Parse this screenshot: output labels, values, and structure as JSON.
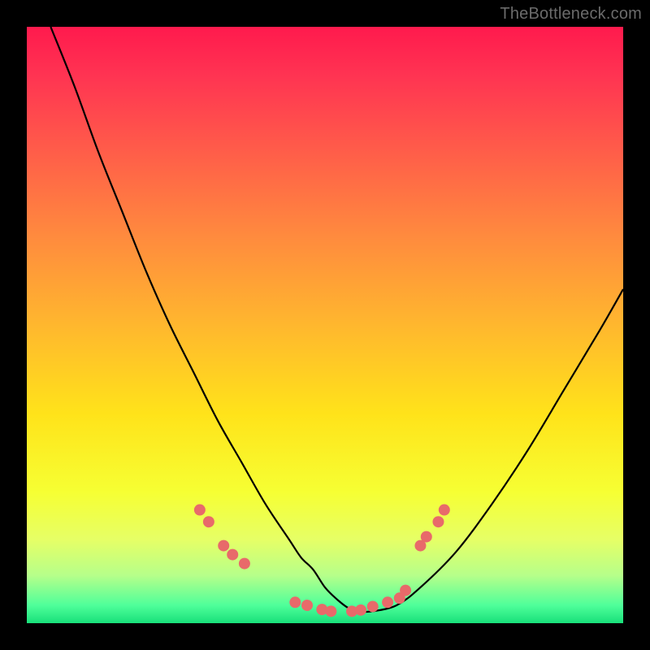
{
  "watermark": "TheBottleneck.com",
  "colors": {
    "page_bg": "#000000",
    "curve_stroke": "#000000",
    "marker_fill": "#e86a6a",
    "gradient_stops": [
      "#ff1a4d",
      "#ff3352",
      "#ff5a4a",
      "#ff8a3e",
      "#ffb72e",
      "#ffe31a",
      "#f6ff33",
      "#e6ff66",
      "#b6ff8a",
      "#4fff9a",
      "#18e07a"
    ]
  },
  "chart_data": {
    "type": "line",
    "title": "",
    "xlabel": "",
    "ylabel": "",
    "xlim": [
      0,
      100
    ],
    "ylim": [
      0,
      100
    ],
    "grid": false,
    "series": [
      {
        "name": "bottleneck-curve",
        "x": [
          4,
          8,
          12,
          16,
          20,
          24,
          28,
          32,
          36,
          40,
          44,
          46,
          48,
          50,
          52,
          54,
          56,
          58,
          62,
          66,
          72,
          78,
          84,
          90,
          96,
          100
        ],
        "y": [
          100,
          90,
          79,
          69,
          59,
          50,
          42,
          34,
          27,
          20,
          14,
          11,
          9,
          6,
          4,
          2.5,
          2,
          2,
          3,
          6,
          12,
          20,
          29,
          39,
          49,
          56
        ]
      }
    ],
    "markers": [
      {
        "x": 29,
        "y": 19
      },
      {
        "x": 30.5,
        "y": 17
      },
      {
        "x": 33,
        "y": 13
      },
      {
        "x": 34.5,
        "y": 11.5
      },
      {
        "x": 36.5,
        "y": 10
      },
      {
        "x": 45,
        "y": 3.5
      },
      {
        "x": 47,
        "y": 3
      },
      {
        "x": 49.5,
        "y": 2.3
      },
      {
        "x": 51,
        "y": 2
      },
      {
        "x": 54.5,
        "y": 2
      },
      {
        "x": 56,
        "y": 2.2
      },
      {
        "x": 58,
        "y": 2.8
      },
      {
        "x": 60.5,
        "y": 3.5
      },
      {
        "x": 62.5,
        "y": 4.2
      },
      {
        "x": 63.5,
        "y": 5.5
      },
      {
        "x": 66,
        "y": 13
      },
      {
        "x": 67,
        "y": 14.5
      },
      {
        "x": 69,
        "y": 17
      },
      {
        "x": 70,
        "y": 19
      }
    ],
    "annotations": []
  }
}
